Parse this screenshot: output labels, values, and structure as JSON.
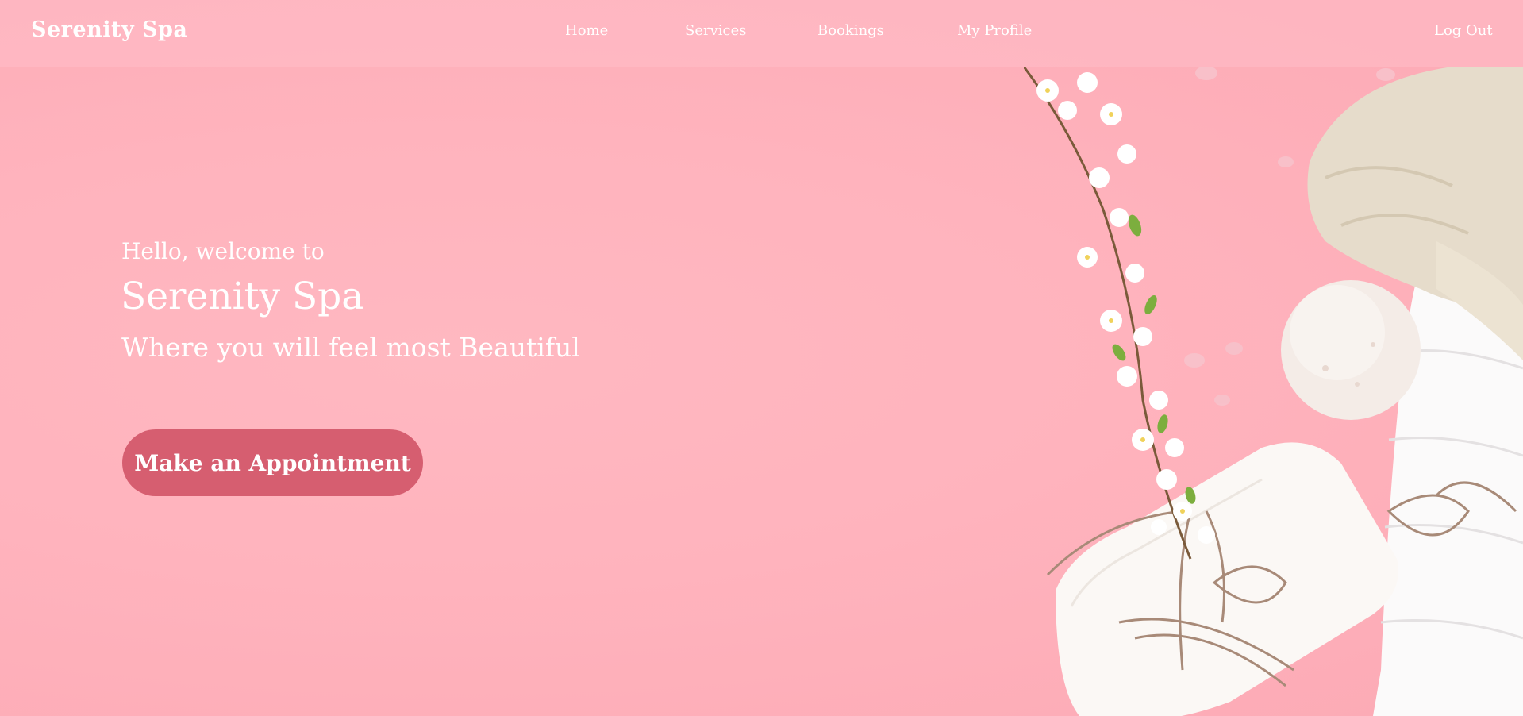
{
  "nav": {
    "brand": "Serenity Spa",
    "links": [
      "Home",
      "Services",
      "Bookings",
      "My Profile"
    ],
    "logout": "Log Out"
  },
  "hero": {
    "greeting": "Hello, welcome to",
    "title": "Serenity Spa",
    "tagline": "Where you will feel most Beautiful",
    "cta_label": "Make an Appointment"
  },
  "colors": {
    "background": "#ffb3bd",
    "cta": "#d65e70",
    "text": "#ffffff"
  },
  "image": {
    "subject": "spa-stones-soap-towel-flowers-photo"
  }
}
